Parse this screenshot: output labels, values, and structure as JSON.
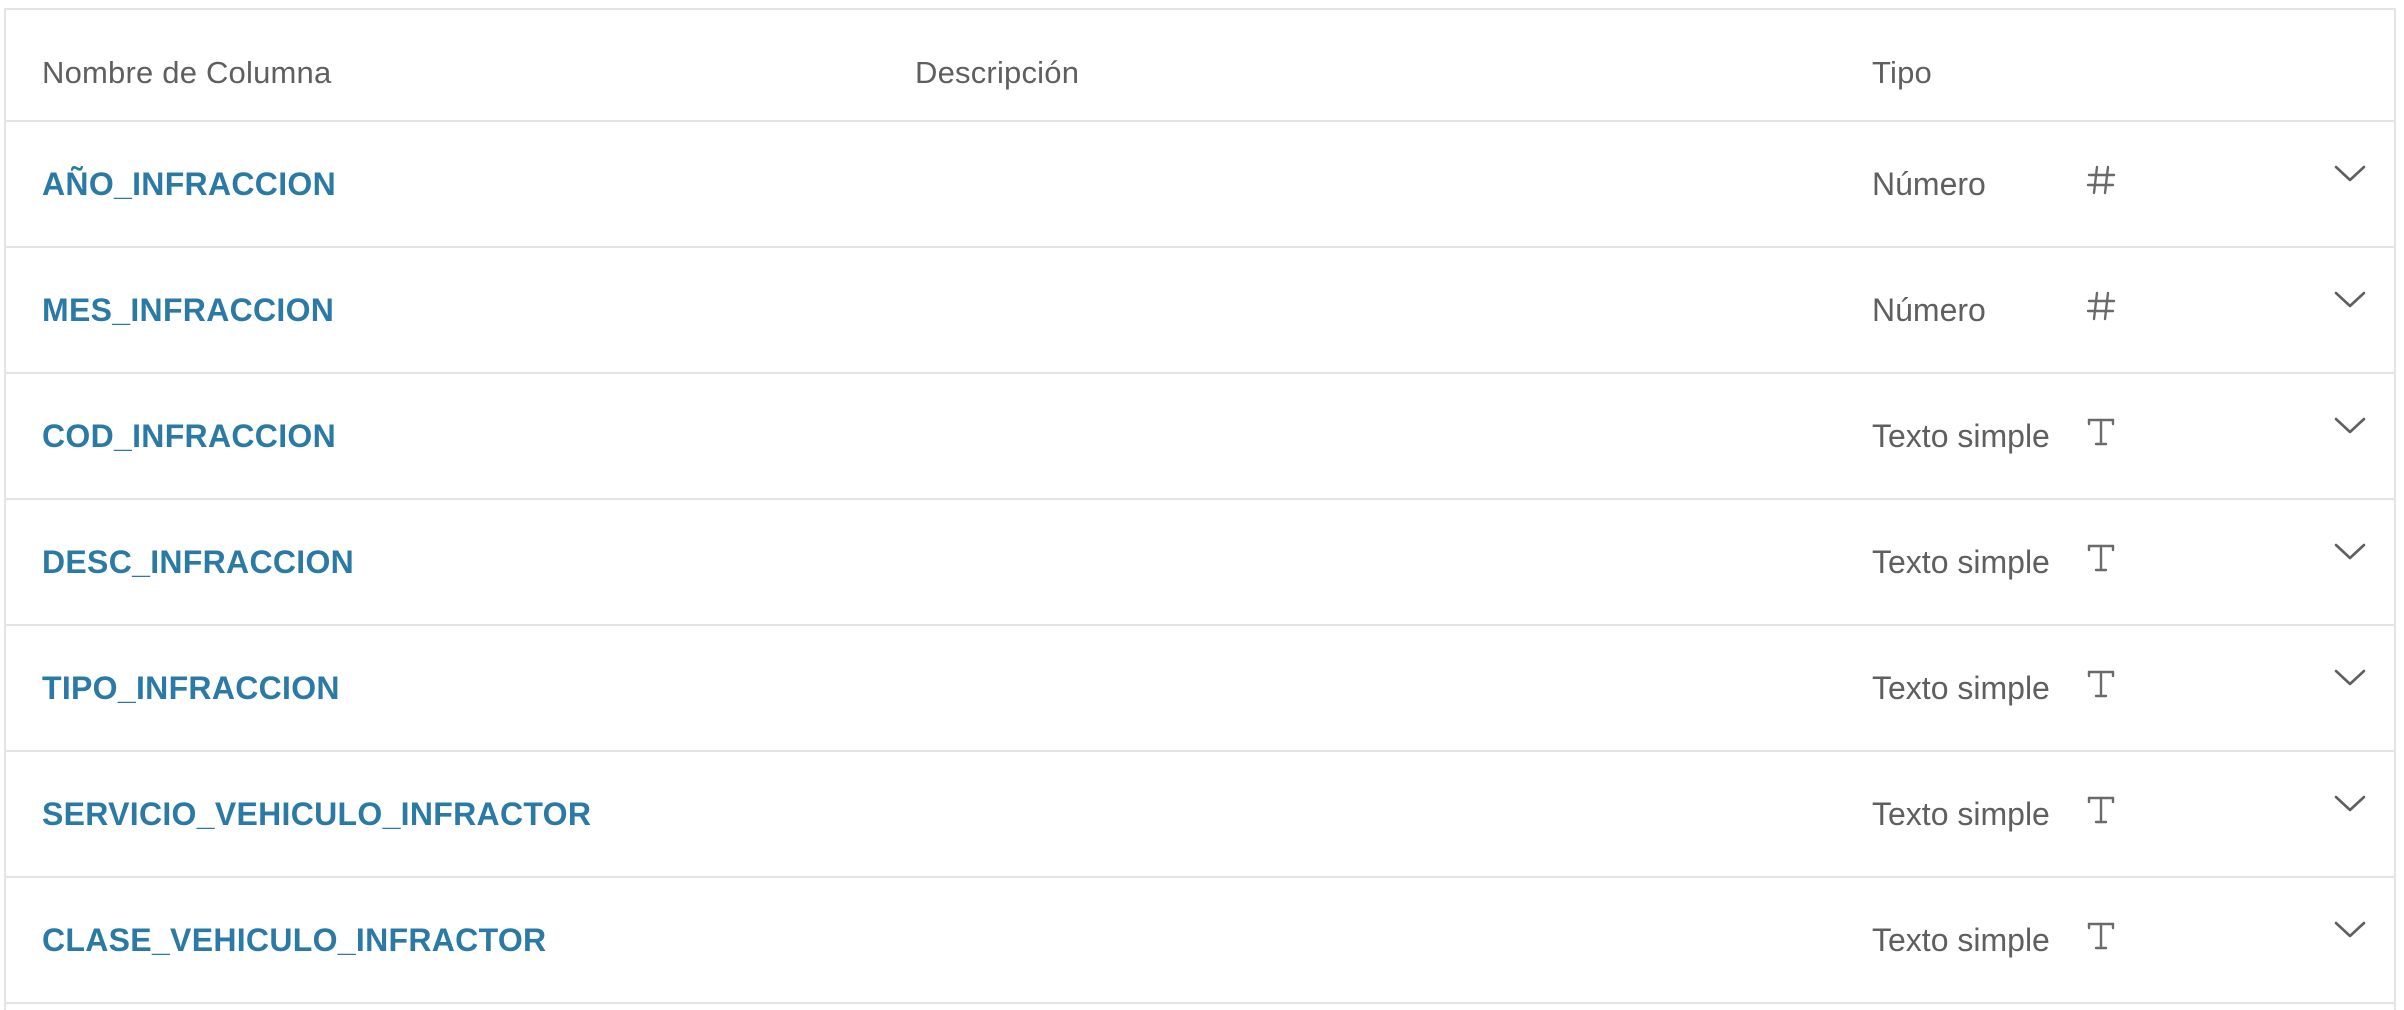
{
  "header": {
    "name": "Nombre de Columna",
    "description": "Descripción",
    "type": "Tipo"
  },
  "rows": [
    {
      "name": "AÑO_INFRACCION",
      "type": "Número",
      "icon": "hash-icon"
    },
    {
      "name": "MES_INFRACCION",
      "type": "Número",
      "icon": "hash-icon"
    },
    {
      "name": "COD_INFRACCION",
      "type": "Texto simple",
      "icon": "text-icon"
    },
    {
      "name": "DESC_INFRACCION",
      "type": "Texto simple",
      "icon": "text-icon"
    },
    {
      "name": "TIPO_INFRACCION",
      "type": "Texto simple",
      "icon": "text-icon"
    },
    {
      "name": "SERVICIO_VEHICULO_INFRACTOR",
      "type": "Texto simple",
      "icon": "text-icon"
    },
    {
      "name": "CLASE_VEHICULO_INFRACTOR",
      "type": "Texto simple",
      "icon": "text-icon"
    }
  ],
  "colors": {
    "link": "#2a7aa5",
    "text": "#5f5f5f",
    "border": "#e4e4e4"
  }
}
